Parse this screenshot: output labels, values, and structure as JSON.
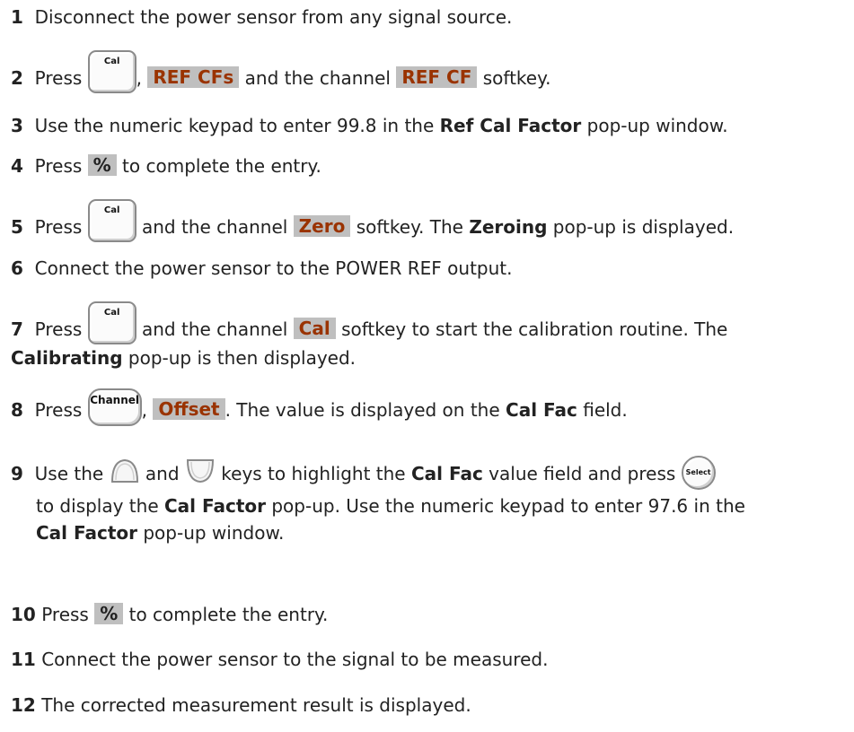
{
  "steps": [
    {
      "num": "1",
      "text": "Disconnect the power sensor from any signal source."
    },
    {
      "num": "2",
      "a": "Press",
      "b": ",",
      "softkey1": "REF CFs",
      "c": "and the channel",
      "softkey2": "REF CF",
      "d": "softkey."
    },
    {
      "num": "3",
      "a": "Use the numeric keypad to enter 99.8 in the",
      "bold": "Ref Cal Factor",
      "b": "pop-up window."
    },
    {
      "num": "4",
      "a": "Press",
      "softkey": "%",
      "b": "to complete the entry."
    },
    {
      "num": "5",
      "a": "Press",
      "b": "and the channel",
      "softkey": "Zero",
      "c": "softkey. The",
      "bold": "Zeroing",
      "d": "pop-up is displayed."
    },
    {
      "num": "6",
      "text": "Connect the power sensor to the POWER REF output."
    },
    {
      "num": "7",
      "a": "Press",
      "b": "and the channel",
      "softkey": "Cal",
      "c": "softkey to start the calibration routine. The",
      "bold": "Calibrating",
      "d": "pop-up is then displayed."
    },
    {
      "num": "8",
      "a": "Press",
      "b": ",",
      "softkey": "Offset",
      "c": ". The value is displayed on the",
      "bold": "Cal Fac",
      "d": "field."
    },
    {
      "num": "9",
      "a": "Use the",
      "b": "and",
      "c": "keys to highlight the",
      "bold1": "Cal Fac",
      "d": "value field and press",
      "e": "to display the",
      "bold2": "Cal Factor",
      "f": "pop-up. Use the numeric keypad to enter 97.6 in the",
      "bold3": "Cal Factor",
      "g": "pop-up window."
    },
    {
      "num": "10",
      "a": "Press",
      "softkey": "%",
      "b": "to complete the entry."
    },
    {
      "num": "11",
      "text": "Connect the power sensor to the signal to be measured."
    },
    {
      "num": "12",
      "text": "The corrected measurement result is displayed."
    }
  ],
  "keys": {
    "cal": "Cal",
    "channel": "Channel",
    "select": "Select"
  },
  "icons": {
    "up": "up-arrow-key-icon",
    "down": "down-arrow-key-icon"
  },
  "colors": {
    "softkey_bg": "#bfbfbf",
    "softkey_text": "#9a3300"
  }
}
